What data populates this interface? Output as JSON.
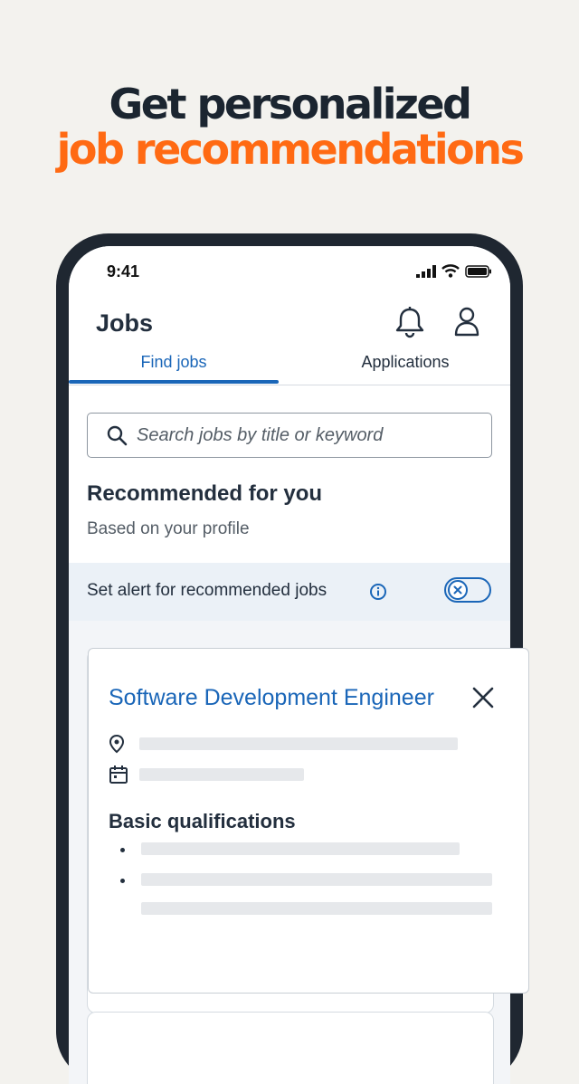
{
  "promo": {
    "headline_line1": "Get personalized",
    "headline_line2": "job recommendations"
  },
  "status_bar": {
    "time": "9:41"
  },
  "header": {
    "title": "Jobs",
    "tabs": [
      {
        "label": "Find jobs",
        "active": true
      },
      {
        "label": "Applications",
        "active": false
      }
    ]
  },
  "search": {
    "placeholder": "Search jobs by title or keyword"
  },
  "recommendations": {
    "title": "Recommended for you",
    "subtitle": "Based on your profile"
  },
  "alert": {
    "label": "Set alert for recommended jobs",
    "enabled": false
  },
  "job_card": {
    "title": "Software Development Engineer",
    "section_heading": "Basic qualifications"
  },
  "colors": {
    "accent_orange": "#ff6a13",
    "link_blue": "#1a66b8",
    "text_dark": "#232f3e",
    "background": "#f3f2ee"
  }
}
